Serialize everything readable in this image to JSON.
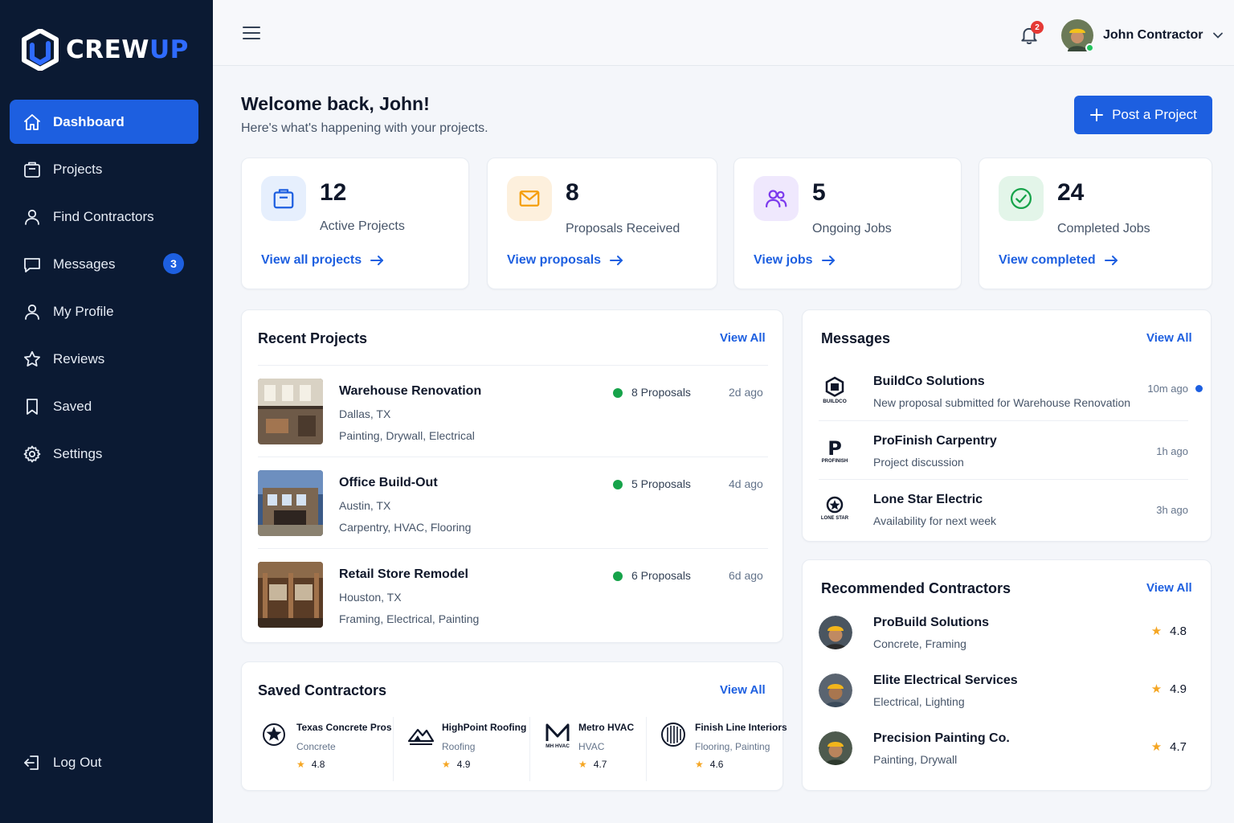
{
  "brand": {
    "name_part1": "CREW",
    "name_part2": "UP"
  },
  "sidebar": {
    "items": [
      {
        "label": "Dashboard",
        "icon": "home-icon",
        "active": true
      },
      {
        "label": "Projects",
        "icon": "briefcase-icon"
      },
      {
        "label": "Find Contractors",
        "icon": "user-icon"
      },
      {
        "label": "Messages",
        "icon": "chat-icon",
        "badge": "3"
      },
      {
        "label": "My Profile",
        "icon": "user-icon"
      },
      {
        "label": "Reviews",
        "icon": "star-icon"
      },
      {
        "label": "Saved",
        "icon": "bookmark-icon"
      },
      {
        "label": "Settings",
        "icon": "gear-icon"
      }
    ],
    "logout_label": "Log Out"
  },
  "header": {
    "notifications_count": "2",
    "user_name": "John Contractor"
  },
  "welcome": {
    "title": "Welcome back, John!",
    "subtitle": "Here's what's happening with your projects.",
    "post_button": "Post a Project"
  },
  "stats": [
    {
      "value": "12",
      "label": "Active Projects",
      "link": "View all projects",
      "color": "#1d5fe0",
      "bg": "#e6effd"
    },
    {
      "value": "8",
      "label": "Proposals Received",
      "link": "View proposals",
      "color": "#f59e0b",
      "bg": "#fdf0dd"
    },
    {
      "value": "5",
      "label": "Ongoing Jobs",
      "link": "View jobs",
      "color": "#7c3aed",
      "bg": "#efe8fd"
    },
    {
      "value": "24",
      "label": "Completed Jobs",
      "link": "View completed",
      "color": "#16a34a",
      "bg": "#e3f5e9"
    }
  ],
  "recent_projects": {
    "title": "Recent Projects",
    "view_all": "View All",
    "items": [
      {
        "name": "Warehouse Renovation",
        "location": "Dallas, TX",
        "trades": "Painting, Drywall, Electrical",
        "proposals": "8 Proposals",
        "time": "2d ago"
      },
      {
        "name": "Office Build-Out",
        "location": "Austin, TX",
        "trades": "Carpentry, HVAC, Flooring",
        "proposals": "5 Proposals",
        "time": "4d ago"
      },
      {
        "name": "Retail Store Remodel",
        "location": "Houston, TX",
        "trades": "Framing, Electrical, Painting",
        "proposals": "6 Proposals",
        "time": "6d ago"
      }
    ]
  },
  "messages": {
    "title": "Messages",
    "view_all": "View All",
    "items": [
      {
        "from": "BuildCo Solutions",
        "logo_text": "BUILDCO",
        "text": "New proposal submitted for Warehouse Renovation",
        "time": "10m ago",
        "unread": true
      },
      {
        "from": "ProFinish Carpentry",
        "logo_text": "PROFINISH",
        "text": "Project discussion",
        "time": "1h ago"
      },
      {
        "from": "Lone Star Electric",
        "logo_text": "LONE STAR",
        "text": "Availability for next week",
        "time": "3h ago"
      }
    ]
  },
  "recommended": {
    "title": "Recommended Contractors",
    "view_all": "View All",
    "items": [
      {
        "name": "ProBuild Solutions",
        "trades": "Concrete, Framing",
        "rating": "4.8"
      },
      {
        "name": "Elite Electrical Services",
        "trades": "Electrical, Lighting",
        "rating": "4.9"
      },
      {
        "name": "Precision Painting Co.",
        "trades": "Painting, Drywall",
        "rating": "4.7"
      }
    ]
  },
  "saved_contractors": {
    "title": "Saved Contractors",
    "view_all": "View All",
    "items": [
      {
        "name": "Texas Concrete Pros",
        "category": "Concrete",
        "rating": "4.8"
      },
      {
        "name": "HighPoint Roofing",
        "category": "Roofing",
        "rating": "4.9"
      },
      {
        "name": "Metro HVAC",
        "category": "HVAC",
        "rating": "4.7",
        "logo_text": "MH HVAC"
      },
      {
        "name": "Finish Line Interiors",
        "category": "Flooring, Painting",
        "rating": "4.6"
      }
    ]
  }
}
